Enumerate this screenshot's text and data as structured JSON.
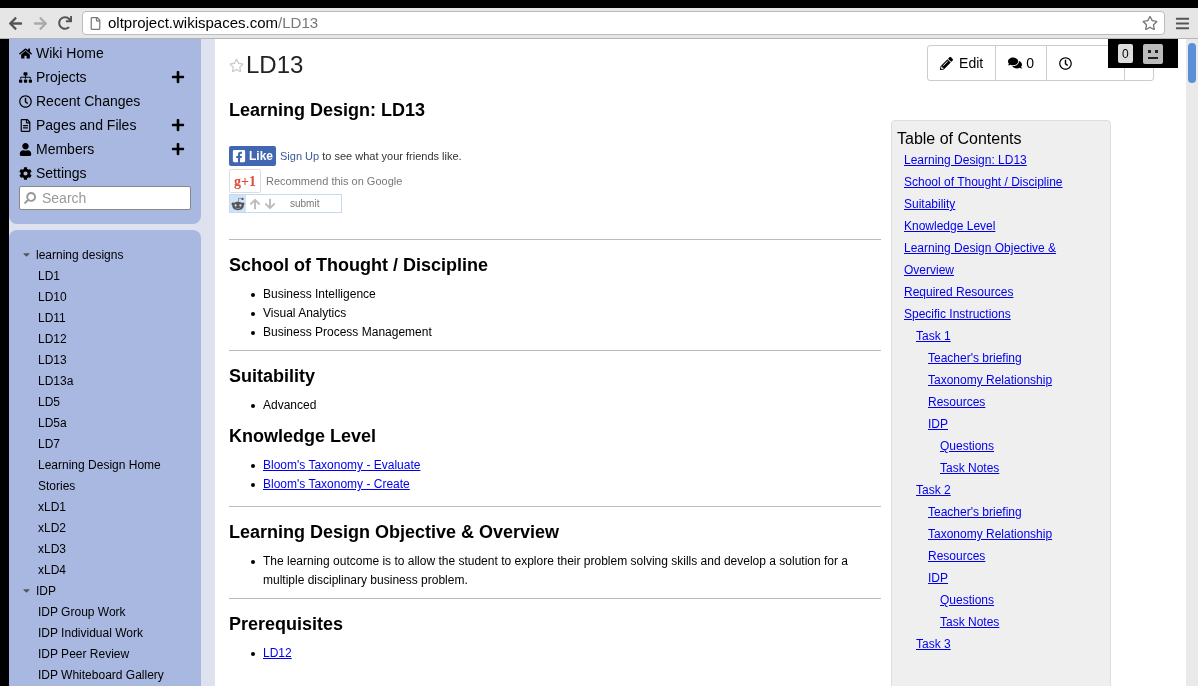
{
  "browser": {
    "url_host": "oltproject.wikispaces.com",
    "url_path": "/LD13"
  },
  "nav": [
    {
      "label": "Wiki Home",
      "add": false
    },
    {
      "label": "Projects",
      "add": true
    },
    {
      "label": "Recent Changes",
      "add": false
    },
    {
      "label": "Pages and Files",
      "add": true
    },
    {
      "label": "Members",
      "add": true
    },
    {
      "label": "Settings",
      "add": false
    }
  ],
  "search": {
    "placeholder": "Search"
  },
  "tree": [
    {
      "label": "learning designs",
      "expanded": true,
      "children": [
        {
          "label": "LD1"
        },
        {
          "label": "LD10"
        },
        {
          "label": "LD11"
        },
        {
          "label": "LD12"
        },
        {
          "label": "LD13"
        },
        {
          "label": "LD13a"
        },
        {
          "label": "LD5"
        },
        {
          "label": "LD5a"
        },
        {
          "label": "LD7"
        },
        {
          "label": "Learning Design Home"
        },
        {
          "label": "Stories"
        },
        {
          "label": "xLD1"
        },
        {
          "label": "xLD2"
        },
        {
          "label": "xLD3"
        },
        {
          "label": "xLD4"
        }
      ]
    },
    {
      "label": "IDP",
      "expanded": true,
      "children": [
        {
          "label": "IDP Group Work"
        },
        {
          "label": "IDP Individual Work"
        },
        {
          "label": "IDP Peer Review"
        },
        {
          "label": "IDP Whiteboard Gallery"
        }
      ]
    }
  ],
  "page": {
    "title": "LD13",
    "starred": false
  },
  "toolbar": {
    "edit": "Edit",
    "comments": "0"
  },
  "overlay": {
    "count": "0"
  },
  "heading": "Learning Design: LD13",
  "social": {
    "like": "Like",
    "like_link": "Sign Up",
    "like_text": "to see what your friends like.",
    "gplus": "g+1",
    "gplus_text": "Recommend this on Google",
    "submit": "submit"
  },
  "sections": [
    {
      "title": "School of Thought / Discipline",
      "rule": true,
      "items": [
        {
          "text": "Business Intelligence",
          "link": false
        },
        {
          "text": "Visual Analytics",
          "link": false
        },
        {
          "text": "Business Process Management",
          "link": false
        }
      ]
    },
    {
      "title": "Suitability",
      "rule": true,
      "items": [
        {
          "text": "Advanced",
          "link": false
        }
      ]
    },
    {
      "title": "Knowledge Level",
      "rule": false,
      "items": [
        {
          "text": "Bloom's Taxonomy - Evaluate",
          "link": true
        },
        {
          "text": "Bloom's Taxonomy - Create",
          "link": true
        }
      ]
    },
    {
      "title": "Learning Design Objective & Overview",
      "rule": true,
      "items": [
        {
          "text": "The learning outcome is to allow the student to explore their problem solving skills and develop a solution for a multiple disciplinary business problem.",
          "link": false
        }
      ]
    },
    {
      "title": "Prerequisites",
      "rule": true,
      "items": [
        {
          "text": "LD12",
          "link": true
        }
      ]
    }
  ],
  "toc": {
    "title": "Table of Contents",
    "items": [
      {
        "label": "Learning Design: LD13"
      },
      {
        "label": "School of Thought / Discipline"
      },
      {
        "label": "Suitability"
      },
      {
        "label": "Knowledge Level"
      },
      {
        "label": "Learning Design Objective & Overview"
      },
      {
        "label": "Required Resources"
      },
      {
        "label": "Specific Instructions",
        "children": [
          {
            "label": "Task 1",
            "children": [
              {
                "label": "Teacher's briefing"
              },
              {
                "label": "Taxonomy Relationship"
              },
              {
                "label": "Resources"
              },
              {
                "label": "IDP",
                "children": [
                  {
                    "label": "Questions"
                  },
                  {
                    "label": "Task Notes"
                  }
                ]
              }
            ]
          },
          {
            "label": "Task 2",
            "children": [
              {
                "label": "Teacher's briefing"
              },
              {
                "label": "Taxonomy Relationship"
              },
              {
                "label": "Resources"
              },
              {
                "label": "IDP",
                "children": [
                  {
                    "label": "Questions"
                  },
                  {
                    "label": "Task Notes"
                  }
                ]
              }
            ]
          },
          {
            "label": "Task 3"
          }
        ]
      }
    ]
  }
}
